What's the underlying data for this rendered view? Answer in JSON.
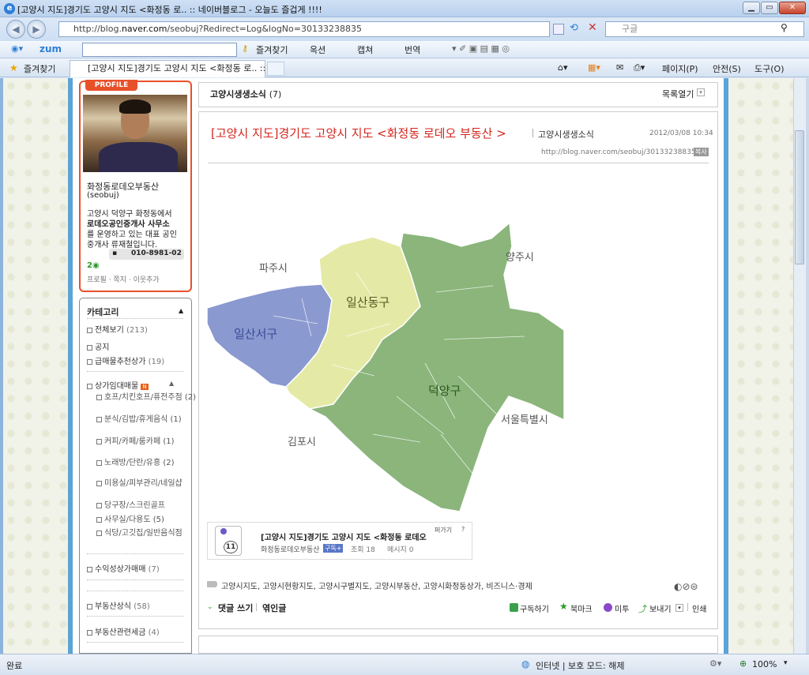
{
  "window": {
    "title": "[고양시 지도]경기도 고양시 지도 <화정동 로.. :: 네이버블로그 - 오늘도 즐겁게 !!!!",
    "minimize": "▁",
    "restore": "▭",
    "close": "✕"
  },
  "addressbar": {
    "url_prefix": "http://blog.",
    "url_host": "naver.com",
    "url_rest": "/seobuj?Redirect=Log&logNo=30133238835",
    "search_placeholder": "구글"
  },
  "zumbar": {
    "brand": "zum",
    "input": "",
    "items": [
      "즐겨찾기",
      "옥션",
      "캡쳐",
      "번역"
    ]
  },
  "favbar": {
    "favorites_label": "즐겨찾기",
    "tab_title": "[고양시 지도]경기도 고양시 지도 <화정동 로.. :: 네...",
    "page_menu": "페이지(P)",
    "safety_menu": "안전(S)",
    "tools_menu": "도구(O)"
  },
  "profile": {
    "badge": "PROFILE",
    "name": "화정동로데오부동산",
    "id": "(seobuj)",
    "desc_lines": [
      "고양시 덕양구 화정동에서",
      "로데오공인중개사 사무소",
      "를 운영하고 있는 대표 공인",
      "중개사 류재철입니다."
    ],
    "phone": "010-8981-02",
    "links": "프로필 · 쪽지 · 이웃추가"
  },
  "category": {
    "title": "카테고리",
    "items": [
      {
        "label": "전체보기",
        "count": "(213)"
      },
      {
        "label": "공지",
        "count": ""
      },
      {
        "label": "급매물추천상가",
        "count": "(19)"
      },
      {
        "label": "상가임대매물",
        "count": ""
      }
    ],
    "subitems": [
      "호프/치킨호프/퓨전주점 (2)",
      "분식/김밥/휴게음식 (1)",
      "커피/카페/룸카페 (1)",
      "노래방/단란/유흥 (2)",
      "미용실/피부관리/네일샵",
      "당구장/스크린골프",
      "사무실/다용도 (5)",
      "식당/고깃집/일반음식점"
    ],
    "more": [
      {
        "label": "수익성상가매매",
        "count": "(7)"
      },
      {
        "label": "부동산상식",
        "count": "(58)"
      },
      {
        "label": "부동산관련세금",
        "count": "(4)"
      }
    ]
  },
  "catbar": {
    "title": "고양시생생소식",
    "count": "(7)",
    "list_toggle": "목록열기"
  },
  "post": {
    "title": "[고양시 지도]경기도 고양시 지도 <화정동 로데오 부동산 >",
    "category": "고양시생생소식",
    "date": "2012/03/08 10:34",
    "link": "http://blog.naver.com/seobuj/30133238835",
    "link_badge": "복사"
  },
  "map": {
    "labels": {
      "paju": "파주시",
      "yangju": "양주시",
      "ilsanseo": "일산서구",
      "ilsandong": "일산동구",
      "deogyang": "덕양구",
      "gimpo": "김포시",
      "seoul": "서울특별시"
    },
    "colors": {
      "ilsanseo": "#8a99cf",
      "ilsandong": "#e4eaa6",
      "deogyang": "#8bb57b",
      "border": "#ffffff"
    }
  },
  "widget": {
    "count": "11",
    "title": "[고양시 지도]경기도 고양시 지도 <화정동 로데오",
    "author": "화정동로데오부동산",
    "subscribe": "구독+",
    "views": "조회 18",
    "memo": "메시지 0",
    "embed": "퍼가기",
    "help": "?"
  },
  "tags": "고양시지도, 고양시현황지도, 고양시구별지도, 고양시부동산, 고양시화정동상가, 비즈니스·경제",
  "actions": {
    "comment": "댓글 쓰기",
    "trackback": "엮인글",
    "subscribe": "구독하기",
    "bookmark": "북마크",
    "metoo": "미투",
    "send": "보내기",
    "print": "인쇄"
  },
  "status": {
    "left": "완료",
    "zone": "인터넷 | 보호 모드: 해제",
    "zoom": "100%"
  }
}
